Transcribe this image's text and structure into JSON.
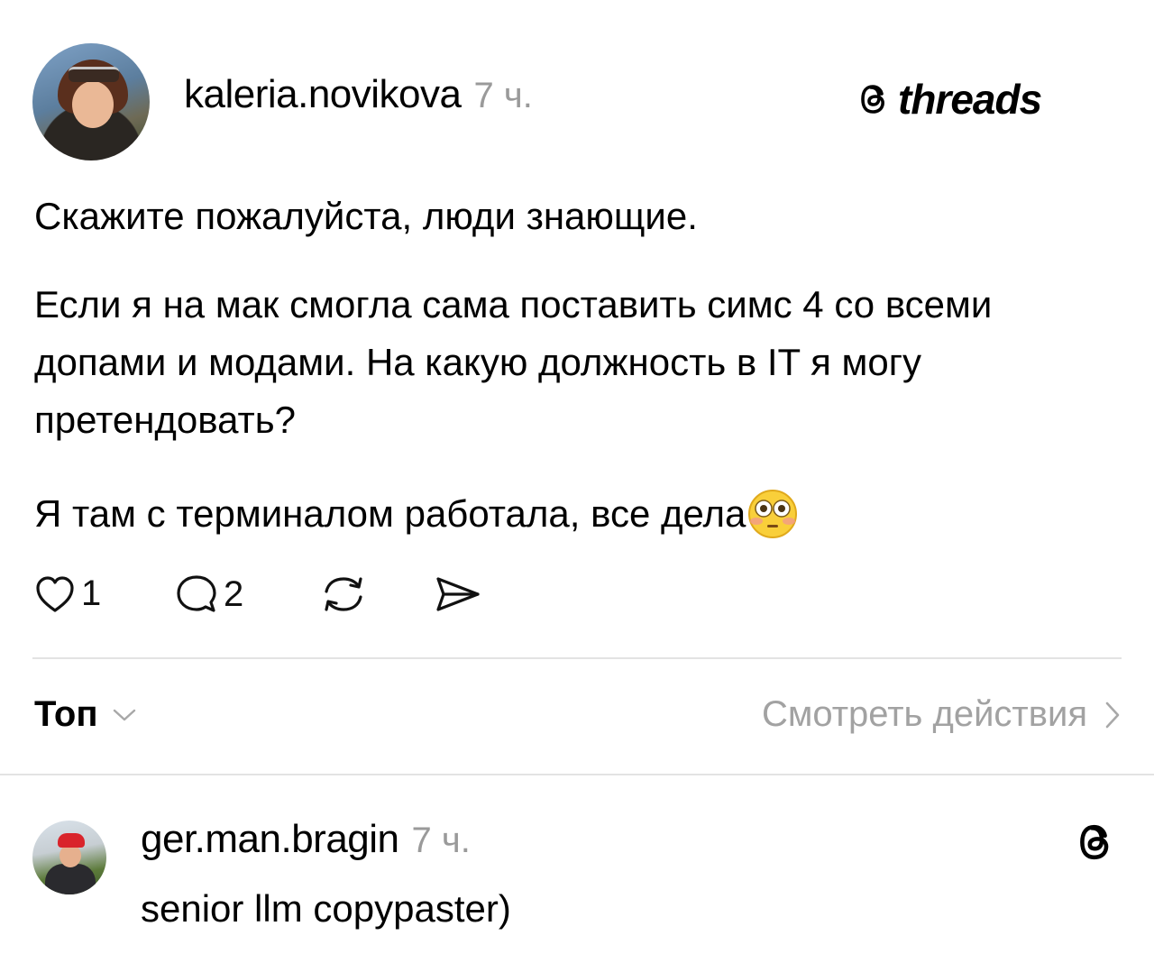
{
  "post": {
    "username": "kaleria.novikova",
    "time": "7 ч.",
    "brand": "threads",
    "paragraphs": [
      "Скажите пожалуйста, люди знающие.",
      "Если я на мак смогла сама поставить симс 4 со всеми допами и модами. На какую должность в IT я могу претендовать?",
      "Я там с терминалом работала, все дела"
    ],
    "emoji": "flushed-face-emoji",
    "actions": {
      "likes": "1",
      "comments": "2"
    }
  },
  "replies_bar": {
    "sort_label": "Топ",
    "view_activity": "Смотреть действия"
  },
  "reply": {
    "username": "ger.man.bragin",
    "time": "7 ч.",
    "text": "senior llm copypaster)"
  }
}
